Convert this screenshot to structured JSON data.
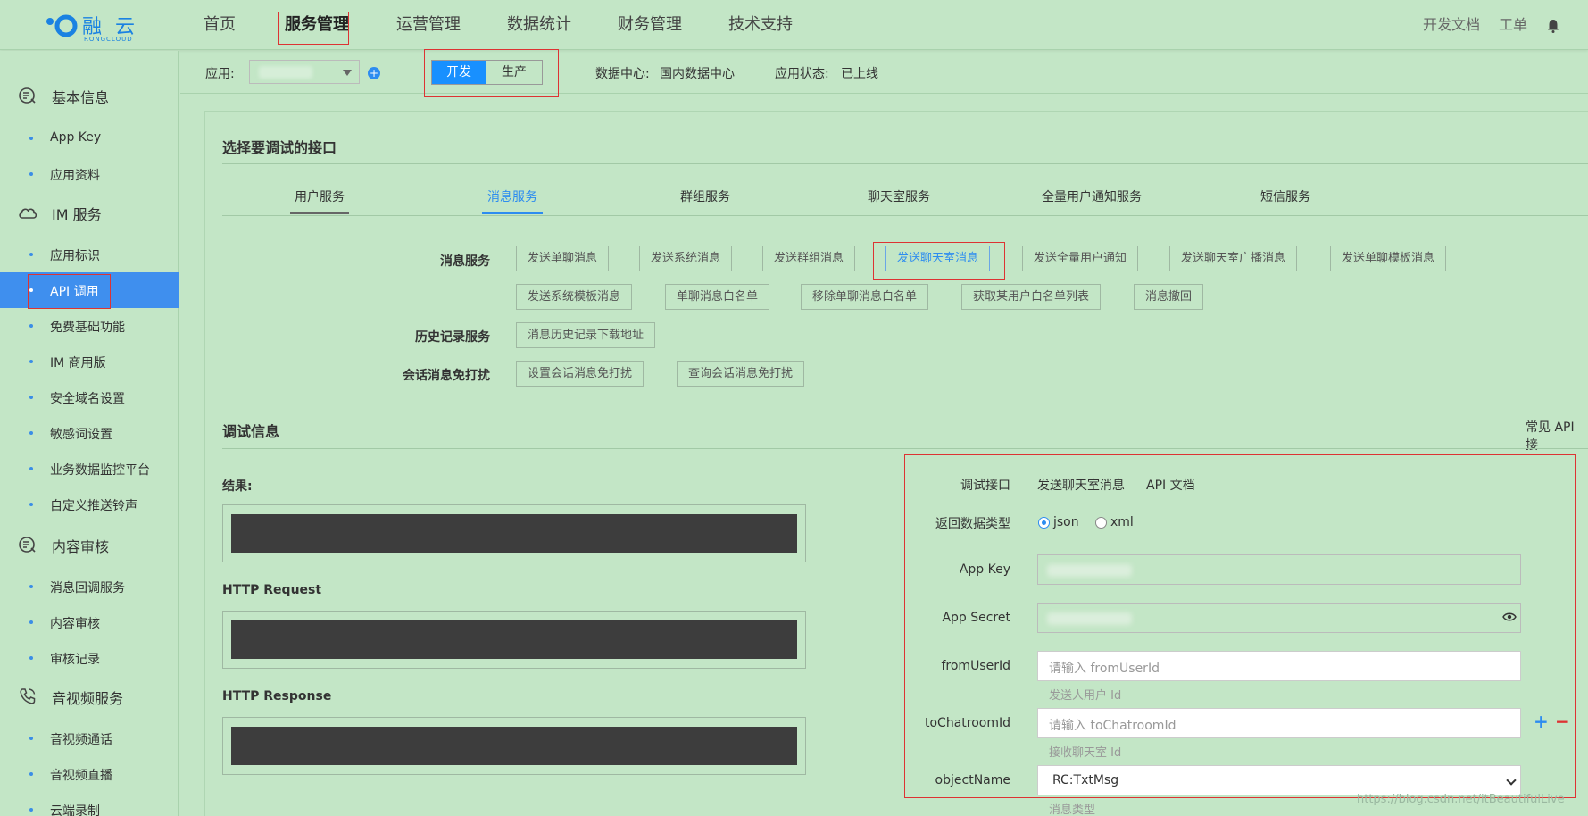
{
  "logo": {
    "text": "融 云",
    "sub": "RONGCLOUD"
  },
  "nav": {
    "items": [
      "首页",
      "服务管理",
      "运营管理",
      "数据统计",
      "财务管理",
      "技术支持"
    ],
    "right": [
      "开发文档",
      "工单"
    ]
  },
  "sidebar": {
    "groups": [
      {
        "label": "基本信息",
        "items": [
          "App Key",
          "应用资料"
        ]
      },
      {
        "label": "IM 服务",
        "items": [
          "应用标识",
          "API 调用",
          "免费基础功能",
          "IM 商用版",
          "安全域名设置",
          "敏感词设置",
          "业务数据监控平台",
          "自定义推送铃声"
        ]
      },
      {
        "label": "内容审核",
        "items": [
          "消息回调服务",
          "内容审核",
          "审核记录"
        ]
      },
      {
        "label": "音视频服务",
        "items": [
          "音视频通话",
          "音视频直播",
          "云端录制"
        ]
      }
    ],
    "active_item": "API 调用"
  },
  "appbar": {
    "app_label": "应用:",
    "env_dev": "开发",
    "env_prod": "生产",
    "datacenter_label": "数据中心:",
    "datacenter_value": "国内数据中心",
    "status_label": "应用状态:",
    "status_value": "已上线"
  },
  "select_section": {
    "title": "选择要调试的接口",
    "tabs": [
      "用户服务",
      "消息服务",
      "群组服务",
      "聊天室服务",
      "全量用户通知服务",
      "短信服务"
    ],
    "active_tab": "消息服务"
  },
  "api_rows": {
    "msg_label": "消息服务",
    "msg_buttons_row1": [
      "发送单聊消息",
      "发送系统消息",
      "发送群组消息",
      "发送聊天室消息",
      "发送全量用户通知",
      "发送聊天室广播消息",
      "发送单聊模板消息"
    ],
    "msg_buttons_row2": [
      "发送系统模板消息",
      "单聊消息白名单",
      "移除单聊消息白名单",
      "获取某用户白名单列表",
      "消息撤回"
    ],
    "history_label": "历史记录服务",
    "history_buttons": [
      "消息历史记录下载地址"
    ],
    "dnd_label": "会话消息免打扰",
    "dnd_buttons": [
      "设置会话消息免打扰",
      "查询会话消息免打扰"
    ],
    "active_button": "发送聊天室消息"
  },
  "debug": {
    "title": "调试信息",
    "right_link": "常见 API 接",
    "result_label": "结果:",
    "request_label": "HTTP Request",
    "response_label": "HTTP Response"
  },
  "form": {
    "api_label": "调试接口",
    "api_value": "发送聊天室消息",
    "api_doc": "API 文档",
    "return_type_label": "返回数据类型",
    "return_json": "json",
    "return_xml": "xml",
    "appkey_label": "App Key",
    "appsecret_label": "App Secret",
    "from_label": "fromUserId",
    "from_placeholder": "请输入 fromUserId",
    "from_hint": "发送人用户 Id",
    "to_label": "toChatroomId",
    "to_placeholder": "请输入 toChatroomId",
    "to_hint": "接收聊天室 Id",
    "object_label": "objectName",
    "object_value": "RC:TxtMsg",
    "object_hint": "消息类型"
  },
  "watermark": "https://blog.csdn.net/itBeautifulLive"
}
